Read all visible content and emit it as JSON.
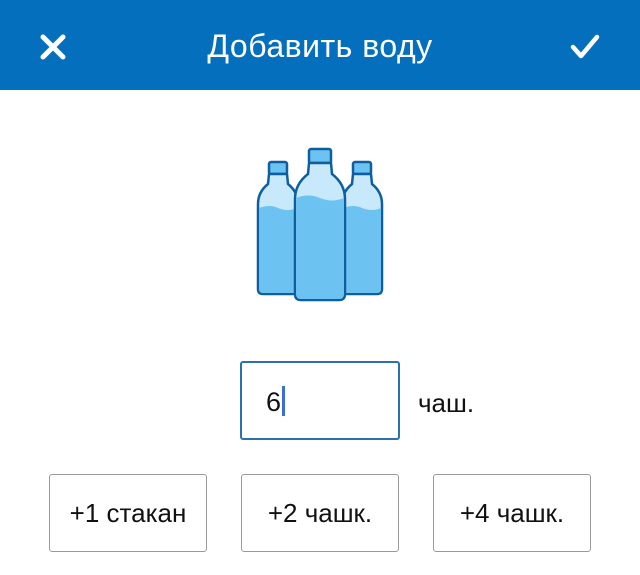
{
  "header": {
    "title": "Добавить воду",
    "close_icon": "close-icon",
    "confirm_icon": "checkmark-icon",
    "color": "#0470bd"
  },
  "illustration": {
    "icon": "water-bottles-icon",
    "water_color": "#6cc3f2",
    "outline_color": "#0f5f9f"
  },
  "amount": {
    "value": "6",
    "unit": "чаш."
  },
  "quick_add": [
    {
      "label": "+1 стакан"
    },
    {
      "label": "+2 чашк."
    },
    {
      "label": "+4 чашк."
    }
  ]
}
